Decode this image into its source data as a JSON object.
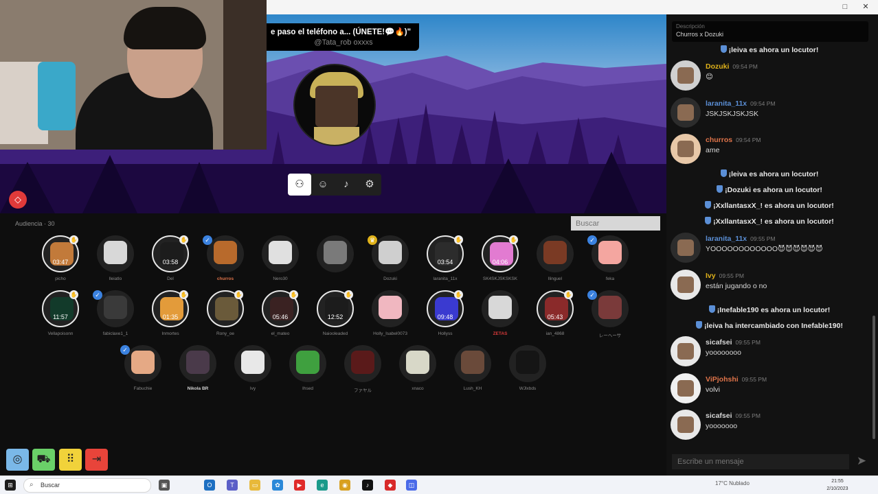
{
  "window": {
    "maximize_icon": "□",
    "close_icon": "✕"
  },
  "stage": {
    "title": "e paso el teléfono a... (ÚNETE!💬🔥)\"",
    "handle": "@Tata_rob oxxxs",
    "tools": [
      {
        "icon": "people-icon",
        "glyph": "⚇"
      },
      {
        "icon": "emoji-icon",
        "glyph": "☺"
      },
      {
        "icon": "music-icon",
        "glyph": "♪"
      },
      {
        "icon": "user-settings-icon",
        "glyph": "⚙"
      }
    ],
    "diamond_glyph": "◇"
  },
  "audience": {
    "label": "Audiencia · 30",
    "search_placeholder": "Buscar",
    "members": [
      {
        "name": "picho",
        "timer": "03:47",
        "style": "normal",
        "bg": "#c27a3a",
        "hand": true
      },
      {
        "name": "lleiatlo",
        "timer": "",
        "style": "normal",
        "bg": "#d8d8d8",
        "hand": false
      },
      {
        "name": "Del",
        "timer": "03:58",
        "style": "normal",
        "bg": "#1c1c1c",
        "hand": true
      },
      {
        "name": "churros",
        "timer": "",
        "style": "hl",
        "bg": "#b86a2c",
        "badge": "verified"
      },
      {
        "name": "Nero30",
        "timer": "",
        "style": "normal",
        "bg": "#e0e0e0"
      },
      {
        "name": "",
        "timer": "",
        "style": "normal",
        "bg": "#7a7a7a"
      },
      {
        "name": "Dozuki",
        "timer": "",
        "style": "normal",
        "bg": "#cfcfcf",
        "badge": "crown"
      },
      {
        "name": "laranita_11x",
        "timer": "03:54",
        "style": "normal",
        "bg": "#2c2c2c",
        "hand": true
      },
      {
        "name": "SK4SKJSKSKSK",
        "timer": "04:06",
        "style": "normal",
        "bg": "#e27bd1",
        "hand": true
      },
      {
        "name": "llinguel",
        "timer": "",
        "style": "normal",
        "bg": "#7a3a24"
      },
      {
        "name": "feka",
        "timer": "",
        "style": "normal",
        "bg": "#f4a6a0",
        "badge": "verified"
      },
      {
        "name": "Vellapoisonn",
        "timer": "11:57",
        "style": "normal",
        "bg": "#123a2a",
        "hand": true
      },
      {
        "name": "fabiclaxe1_1",
        "timer": "",
        "style": "normal",
        "bg": "#3a3a3a",
        "badge": "verified"
      },
      {
        "name": "Inmortes",
        "timer": "01:35",
        "style": "normal",
        "bg": "#e39b3a",
        "hand": true
      },
      {
        "name": "Rony_oe",
        "timer": "",
        "style": "normal",
        "bg": "#6a5a3a",
        "hand": true
      },
      {
        "name": "el_mateo",
        "timer": "05:46",
        "style": "normal",
        "bg": "#3a2222",
        "hand": true
      },
      {
        "name": "Naiooleaded",
        "timer": "12:52",
        "style": "normal",
        "bg": "#1c1c1c",
        "hand": true
      },
      {
        "name": "Holly_Isabel0073",
        "timer": "",
        "style": "normal",
        "bg": "#f0b7c0"
      },
      {
        "name": "Hollyss",
        "timer": "09:48",
        "style": "normal",
        "bg": "#3a3ad0",
        "hand": true
      },
      {
        "name": "ZETAS",
        "timer": "",
        "style": "red",
        "bg": "#d8d8d8"
      },
      {
        "name": "ian_4868",
        "timer": "05:43",
        "style": "normal",
        "bg": "#8a2a2a",
        "hand": true
      },
      {
        "name": "レーヘーサ",
        "timer": "",
        "style": "normal",
        "bg": "#7a3a3a",
        "badge": "verified"
      },
      {
        "name": "Fabuchie",
        "timer": "",
        "style": "normal",
        "bg": "#e5a985",
        "badge": "verified"
      },
      {
        "name": "Nikola BR",
        "timer": "",
        "style": "white",
        "bg": "#4a3a4a"
      },
      {
        "name": "Ivy",
        "timer": "",
        "style": "normal",
        "bg": "#e8e8e8"
      },
      {
        "name": "Ihsed",
        "timer": "",
        "style": "normal",
        "bg": "#3fa03f"
      },
      {
        "name": "ファヤル",
        "timer": "",
        "style": "normal",
        "bg": "#5a1a1a"
      },
      {
        "name": "xnaco",
        "timer": "",
        "style": "normal",
        "bg": "#d8d8c8"
      },
      {
        "name": "Lush_KH",
        "timer": "",
        "style": "normal",
        "bg": "#6a4a3a"
      },
      {
        "name": "WJlxbds",
        "timer": "",
        "style": "normal",
        "bg": "#151515"
      }
    ]
  },
  "bottom_buttons": [
    {
      "icon": "globe-icon",
      "glyph": "◎",
      "color": "#7ab8e8"
    },
    {
      "icon": "cart-icon",
      "glyph": "⛟",
      "color": "#6ad068"
    },
    {
      "icon": "grid-icon",
      "glyph": "⠿",
      "color": "#f1d23a"
    },
    {
      "icon": "exit-icon",
      "glyph": "⇥",
      "color": "#e8443a"
    }
  ],
  "chat": {
    "description_label": "Descripción",
    "description_value": "Churros x Dozuki",
    "input_placeholder": "Escribe un mensaje",
    "items": [
      {
        "type": "system",
        "text": "¡leiva es ahora un locutor!"
      },
      {
        "type": "msg",
        "user": "Dozuki",
        "user_color": "#e0b21a",
        "time": "09:54 PM",
        "text": "😊",
        "avatar_color": "#d0d0d0"
      },
      {
        "type": "msg",
        "user": "laranita_11x",
        "user_color": "#5b8fd6",
        "time": "09:54 PM",
        "text": "JSKJSKJSKJSK",
        "avatar_color": "#2c2c2c"
      },
      {
        "type": "msg",
        "user": "churros",
        "user_color": "#e0744a",
        "time": "09:54 PM",
        "text": "ame",
        "avatar_color": "#e8c8a8"
      },
      {
        "type": "system",
        "text": "¡leiva es ahora un locutor!"
      },
      {
        "type": "system",
        "text": "¡Dozuki es ahora un locutor!"
      },
      {
        "type": "system",
        "text": "¡XxllantasxX_! es ahora un locutor!"
      },
      {
        "type": "system",
        "text": "¡XxllantasxX_! es ahora un locutor!"
      },
      {
        "type": "msg",
        "user": "laranita_11x",
        "user_color": "#5b8fd6",
        "time": "09:55 PM",
        "text": "YOOOOOOOOOOOO😈😈😈😈😈😈",
        "avatar_color": "#2c2c2c"
      },
      {
        "type": "msg",
        "user": "Ivy",
        "user_color": "#e0b21a",
        "time": "09:55 PM",
        "text": "están jugando o no",
        "avatar_color": "#e8e8e8"
      },
      {
        "type": "system",
        "text": "¡Inefable190 es ahora un locutor!"
      },
      {
        "type": "system",
        "text": "¡leiva ha intercambiado con Inefable190!"
      },
      {
        "type": "msg",
        "user": "sicafsei",
        "user_color": "#d6d6d6",
        "time": "09:55 PM",
        "text": "yoooooooo",
        "avatar_color": "#e8e8e8"
      },
      {
        "type": "msg",
        "user": "ViPjohshi",
        "user_color": "#e0744a",
        "time": "09:55 PM",
        "text": "volvi",
        "avatar_color": "#f0f0f0"
      },
      {
        "type": "msg",
        "user": "sicafsei",
        "user_color": "#d6d6d6",
        "time": "09:55 PM",
        "text": "yooooooo",
        "avatar_color": "#e8e8e8"
      }
    ]
  },
  "taskbar": {
    "search_text": "Buscar",
    "weather": "17°C  Nublado",
    "clock_time": "21:55",
    "clock_date": "2/10/2023",
    "icons": [
      {
        "icon": "windows-icon",
        "color": "#1c1c1c",
        "glyph": "⊞"
      },
      {
        "icon": "task-view-icon",
        "color": "#555",
        "glyph": "▣"
      },
      {
        "icon": "outlook-icon",
        "color": "#1d6fc2",
        "glyph": "O"
      },
      {
        "icon": "teams-icon",
        "color": "#5b5fc7",
        "glyph": "T"
      },
      {
        "icon": "folder-icon",
        "color": "#e8b93a",
        "glyph": "▭"
      },
      {
        "icon": "photos-icon",
        "color": "#2a88d8",
        "glyph": "✿"
      },
      {
        "icon": "youtube-icon",
        "color": "#e02a2a",
        "glyph": "▶"
      },
      {
        "icon": "edge-icon",
        "color": "#1a9a8a",
        "glyph": "e"
      },
      {
        "icon": "chrome-icon",
        "color": "#d8a020",
        "glyph": "◉"
      },
      {
        "icon": "tiktok-icon",
        "color": "#111",
        "glyph": "♪"
      },
      {
        "icon": "app-icon",
        "color": "#d82a2a",
        "glyph": "◆"
      },
      {
        "icon": "app2-icon",
        "color": "#4a6ae8",
        "glyph": "◫"
      }
    ]
  }
}
